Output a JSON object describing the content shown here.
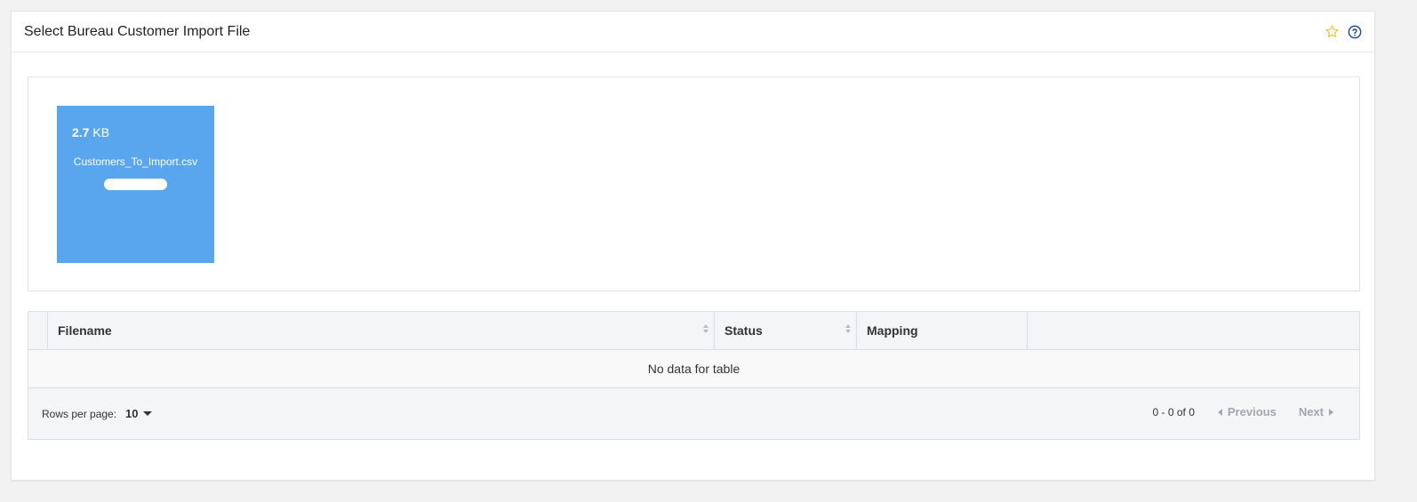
{
  "header": {
    "title": "Select Bureau Customer Import File",
    "favorite_icon": "star-outline-icon",
    "help_icon": "question-circle-icon",
    "accent_color": "#f5c342",
    "help_color": "#1f4e8c"
  },
  "upload": {
    "file_size_value": "2.7",
    "file_size_unit": "KB",
    "file_name": "Customers_To_Import.csv",
    "progress_percent": 100,
    "tile_color": "#5aa6ee"
  },
  "table": {
    "columns": [
      "Filename",
      "Status",
      "Mapping"
    ],
    "empty_text": "No data for table"
  },
  "footer": {
    "rows_per_page_label": "Rows per page:",
    "rows_per_page_value": "10",
    "range_text": "0 - 0 of 0",
    "previous_label": "Previous",
    "next_label": "Next"
  }
}
